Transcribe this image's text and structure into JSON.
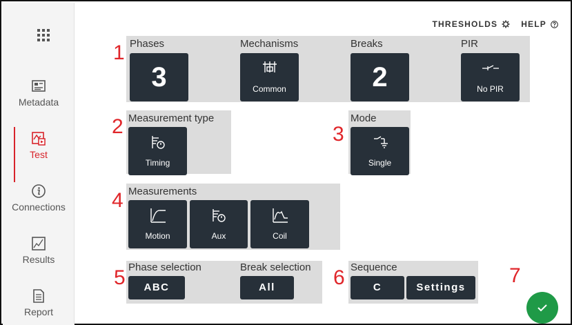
{
  "sidebar": {
    "items": [
      {
        "label": "Metadata",
        "icon": "metadata-icon",
        "active": false
      },
      {
        "label": "Test",
        "icon": "test-icon",
        "active": true
      },
      {
        "label": "Connections",
        "icon": "info-icon",
        "active": false
      },
      {
        "label": "Results",
        "icon": "results-chart-icon",
        "active": false
      },
      {
        "label": "Report",
        "icon": "report-icon",
        "active": false
      }
    ]
  },
  "header": {
    "thresholds": "THRESHOLDS",
    "help": "HELP"
  },
  "callouts": [
    "1",
    "2",
    "3",
    "4",
    "5",
    "6",
    "7"
  ],
  "group1": {
    "phases": {
      "label": "Phases",
      "value": "3"
    },
    "mechanisms": {
      "label": "Mechanisms",
      "value": "Common"
    },
    "breaks": {
      "label": "Breaks",
      "value": "2"
    },
    "pir": {
      "label": "PIR",
      "value": "No PIR"
    }
  },
  "measurement_type": {
    "label": "Measurement type",
    "value": "Timing"
  },
  "mode": {
    "label": "Mode",
    "value": "Single"
  },
  "measurements": {
    "label": "Measurements",
    "items": [
      "Motion",
      "Aux",
      "Coil"
    ]
  },
  "phase_selection": {
    "label": "Phase selection",
    "value": "ABC"
  },
  "break_selection": {
    "label": "Break selection",
    "value": "All"
  },
  "sequence": {
    "label": "Sequence",
    "value": "C",
    "settings": "Settings"
  },
  "colors": {
    "accent": "#d8232a",
    "tile": "#273039",
    "panel": "#dcdcdc",
    "confirm": "#1f9a47"
  }
}
